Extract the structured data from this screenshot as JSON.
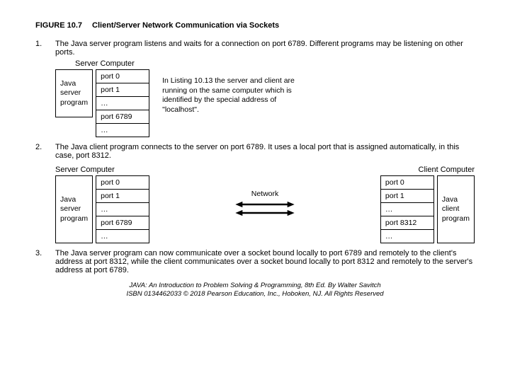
{
  "figure": {
    "label": "FIGURE 10.7",
    "title": "Client/Server Network Communication via Sockets"
  },
  "steps": {
    "s1": {
      "num": "1.",
      "text": "The Java server program listens and waits for a connection on port 6789. Different programs may be listening on other ports."
    },
    "s2": {
      "num": "2.",
      "text": "The Java client program connects to the server on port 6789. It uses a local port that is assigned automatically, in this case, port 8312."
    },
    "s3": {
      "num": "3.",
      "text": "The Java server program can now communicate over a socket bound locally to port 6789 and remotely to the client's address at port 8312, while the client communicates over a socket bound locally to port 8312 and remotely to the server's address at port 6789."
    }
  },
  "labels": {
    "server_computer": "Server Computer",
    "client_computer": "Client Computer",
    "java_server_program": "Java\nserver\nprogram",
    "java_client_program": "Java\nclient\nprogram",
    "network": "Network"
  },
  "ports": {
    "p0": "port 0",
    "p1": "port 1",
    "dots": "…",
    "p6789": "port 6789",
    "p8312": "port 8312"
  },
  "sidenote": "In Listing 10.13 the server and client are running on the same computer which is identified by the special address of \"localhost\".",
  "footer": {
    "line1": "JAVA: An Introduction to Problem Solving & Programming, 8th Ed. By Walter Savitch",
    "line2": "ISBN 0134462033 © 2018 Pearson Education, Inc., Hoboken, NJ. All Rights Reserved"
  }
}
